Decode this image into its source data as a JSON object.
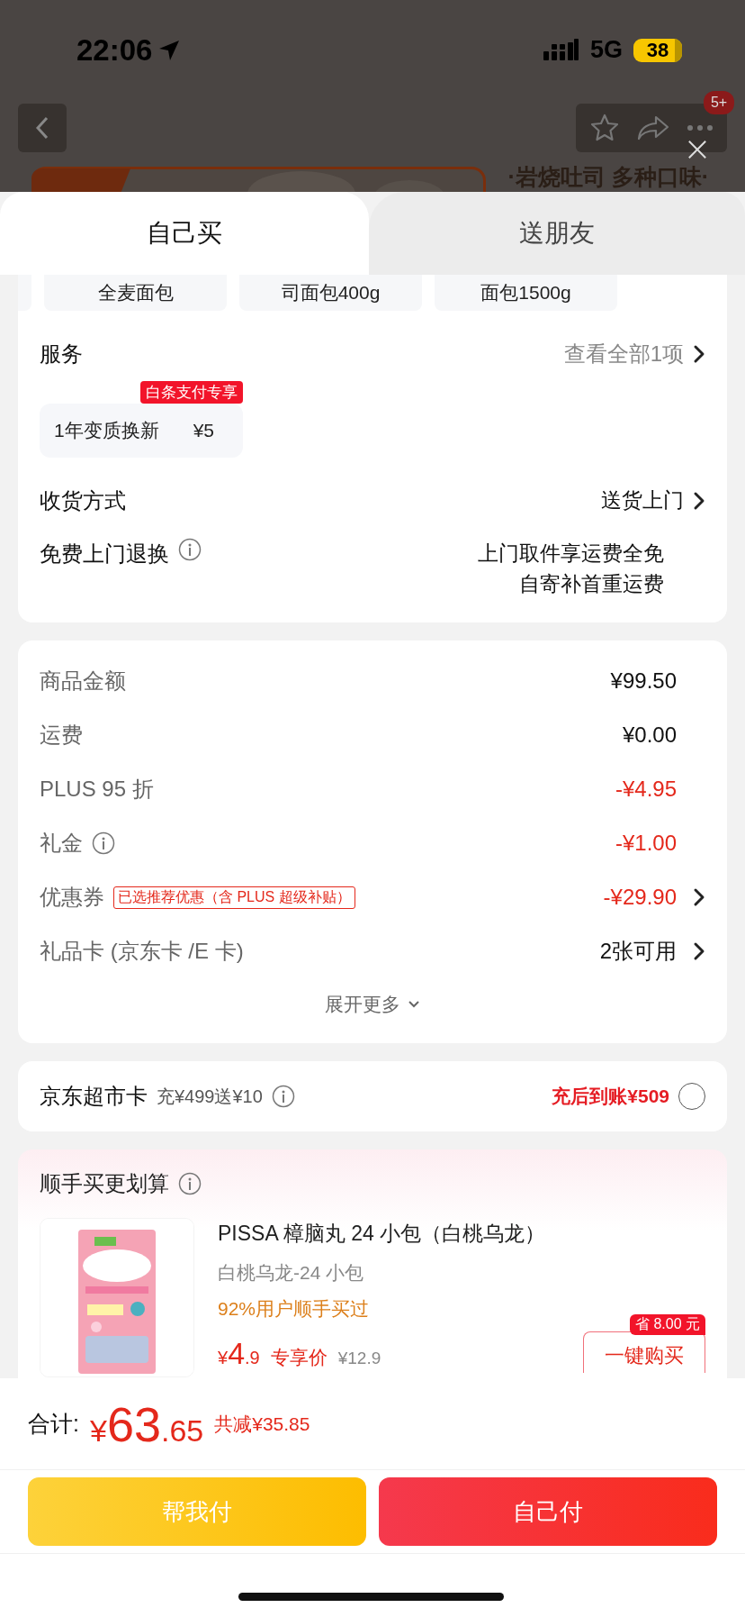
{
  "status_bar": {
    "time": "22:06",
    "network": "5G",
    "battery": "38"
  },
  "nav": {
    "badge": "5+"
  },
  "backdrop": {
    "caption": "·岩烧吐司 多种口味·"
  },
  "tabs": [
    {
      "label": "自己买",
      "selected": true
    },
    {
      "label": "送朋友",
      "selected": false
    }
  ],
  "variants": [
    "全麦面包",
    "司面包400g",
    "面包1500g"
  ],
  "service": {
    "title": "服务",
    "link": "查看全部1项",
    "options": [
      {
        "label": "1年变质换新",
        "price": "¥5",
        "badge": "白条支付专享"
      }
    ]
  },
  "delivery": {
    "label": "收货方式",
    "value": "送货上门"
  },
  "returns": {
    "label": "免费上门退换",
    "lines": [
      "上门取件享运费全免",
      "自寄补首重运费"
    ]
  },
  "costs": [
    {
      "label": "商品金额",
      "value": "¥99.50",
      "kind": "plain"
    },
    {
      "label": "运费",
      "value": "¥0.00",
      "kind": "plain"
    },
    {
      "label": "PLUS 95 折",
      "value": "-¥4.95",
      "kind": "discount"
    },
    {
      "label": "礼金",
      "value": "-¥1.00",
      "kind": "discount",
      "info": true
    },
    {
      "label": "优惠券",
      "tag": "已选推荐优惠（含 PLUS 超级补贴）",
      "value": "-¥29.90",
      "kind": "discount",
      "arrow": true
    },
    {
      "label": "礼品卡 (京东卡 /E 卡)",
      "value": "2张可用",
      "kind": "plain",
      "arrow": true
    }
  ],
  "expand": "展开更多",
  "supermarket_card": {
    "title": "京东超市卡",
    "offer": "充¥499送¥10",
    "result": "充后到账¥509",
    "checked": false
  },
  "addon": {
    "title": "顺手买更划算",
    "product": {
      "name": "PISSA 樟脑丸 24 小包（白桃乌龙）",
      "spec": "白桃乌龙-24 小包",
      "stat": "92%用户顺手买过",
      "currency": "¥",
      "price_int": "4",
      "price_dec": ".9",
      "price_label": "专享价",
      "original_price": "¥12.9",
      "save_badge": "省 8.00 元",
      "button": "一键购买"
    }
  },
  "footer": {
    "total_label": "合计:",
    "currency": "¥",
    "total_int": "63",
    "total_dec": ".65",
    "saved": "共减¥35.85",
    "buttons": [
      {
        "label": "帮我付",
        "kind": "secondary"
      },
      {
        "label": "自己付",
        "kind": "primary"
      }
    ]
  }
}
